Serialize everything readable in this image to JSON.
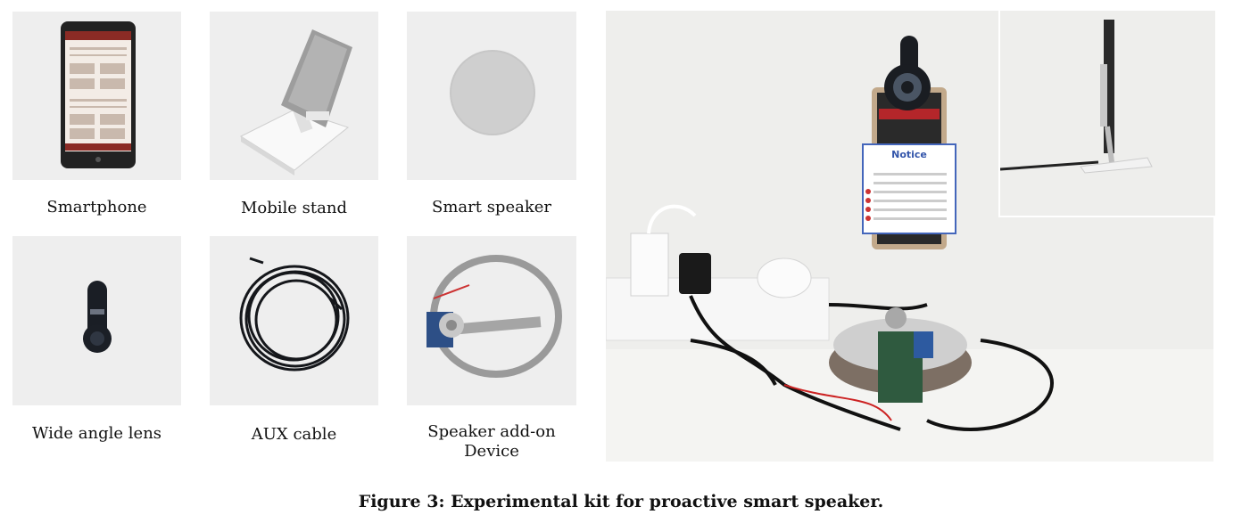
{
  "panels": [
    {
      "caption": "Smartphone"
    },
    {
      "caption": "Mobile stand"
    },
    {
      "caption": "Smart speaker"
    },
    {
      "caption": "Wide angle lens"
    },
    {
      "caption": "AUX cable"
    },
    {
      "caption": "Speaker add-on Device"
    }
  ],
  "notice": {
    "title": "Notice"
  },
  "figure_caption": "Figure 3: Experimental kit for proactive smart speaker."
}
